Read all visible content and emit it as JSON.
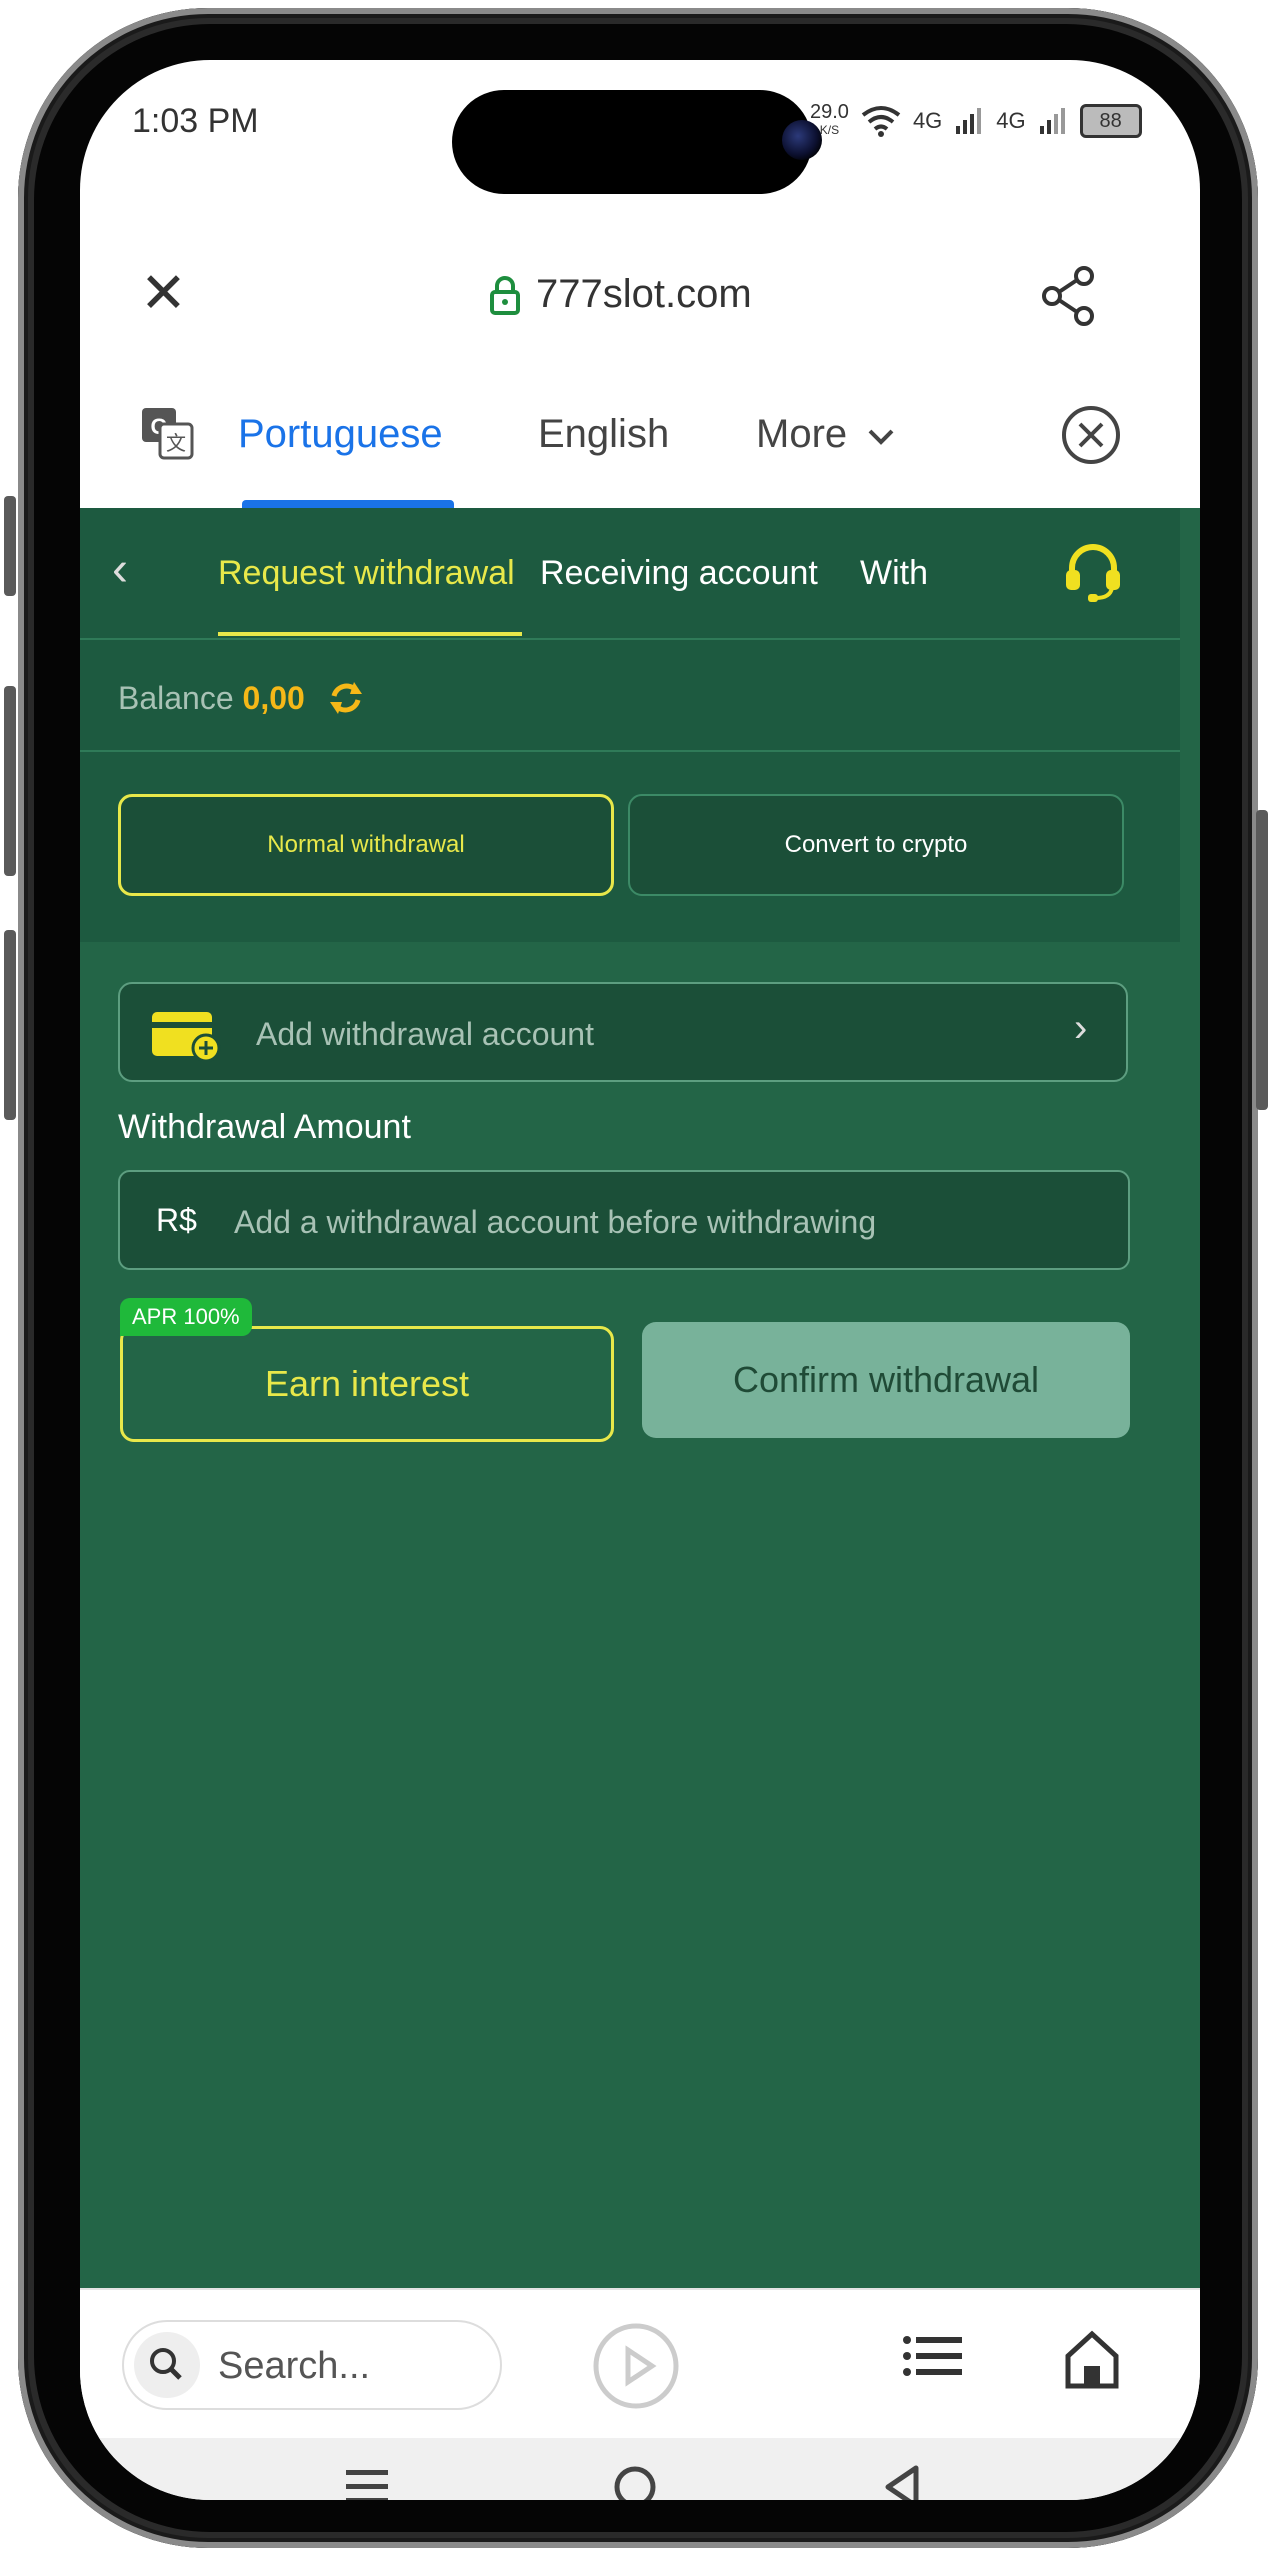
{
  "status_bar": {
    "time": "1:03 PM",
    "net_speed": "29.0",
    "net_speed_unit": "K/S",
    "signal1_label": "4G",
    "signal2_label": "4G",
    "battery": "88"
  },
  "browser": {
    "url": "777slot.com"
  },
  "translate_bar": {
    "tabs": [
      "Portuguese",
      "English",
      "More"
    ]
  },
  "nav": {
    "tabs": [
      "Request withdrawal",
      "Receiving account",
      "With"
    ]
  },
  "balance": {
    "label": "Balance",
    "value": "0,00"
  },
  "withdraw_modes": {
    "normal": "Normal withdrawal",
    "crypto": "Convert to crypto"
  },
  "add_account": {
    "label": "Add withdrawal account"
  },
  "amount": {
    "label": "Withdrawal Amount",
    "currency": "R$",
    "placeholder": "Add a withdrawal account before withdrawing"
  },
  "actions": {
    "apr_badge": "APR 100%",
    "earn_interest": "Earn interest",
    "confirm": "Confirm withdrawal"
  },
  "bottom_bar": {
    "search_placeholder": "Search..."
  },
  "colors": {
    "page_bg": "#236547",
    "accent_yellow": "#e8e84a",
    "balance_orange": "#f5b818",
    "apr_green": "#1fb93a",
    "translate_blue": "#1a73e8"
  }
}
